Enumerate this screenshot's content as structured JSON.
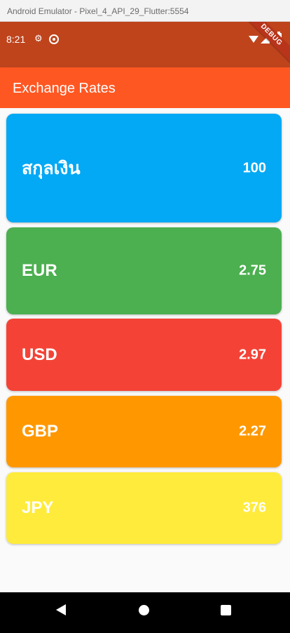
{
  "window": {
    "title": "Android Emulator - Pixel_4_API_29_Flutter:5554"
  },
  "status_bar": {
    "time": "8:21",
    "debug_banner": "DEBUG"
  },
  "app_bar": {
    "title": "Exchange Rates"
  },
  "cards": [
    {
      "label": "สกุลเงิน",
      "value": "100",
      "color": "#03a9f4"
    },
    {
      "label": "EUR",
      "value": "2.75",
      "color": "#4caf50"
    },
    {
      "label": "USD",
      "value": "2.97",
      "color": "#f44336"
    },
    {
      "label": "GBP",
      "value": "2.27",
      "color": "#ff9800"
    },
    {
      "label": "JPY",
      "value": "376",
      "color": "#ffeb3b"
    }
  ],
  "icons": {
    "status": [
      "settings-icon",
      "sync-icon",
      "wifi-icon",
      "signal-icon",
      "battery-icon"
    ],
    "navigation": [
      "back-icon",
      "home-icon",
      "recents-icon"
    ]
  }
}
